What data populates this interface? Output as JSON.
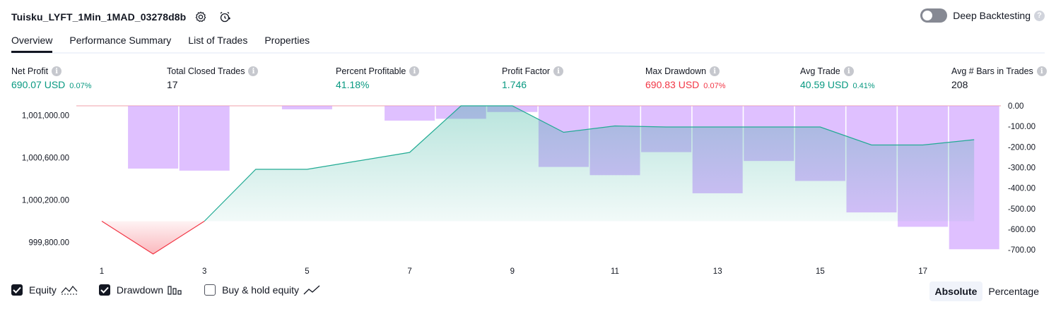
{
  "header": {
    "title": "Tuisku_LYFT_1Min_1MAD_03278d8b",
    "icons": [
      "settings-icon",
      "add-alert-icon"
    ],
    "deep_backtesting_label": "Deep Backtesting",
    "deep_backtesting_enabled": false
  },
  "tabs": [
    {
      "label": "Overview",
      "active": true
    },
    {
      "label": "Performance Summary",
      "active": false
    },
    {
      "label": "List of Trades",
      "active": false
    },
    {
      "label": "Properties",
      "active": false
    }
  ],
  "metrics": [
    {
      "label": "Net Profit",
      "value": "690.07 USD",
      "pct": "0.07%",
      "tone": "pos"
    },
    {
      "label": "Total Closed Trades",
      "value": "17",
      "pct": "",
      "tone": "plain"
    },
    {
      "label": "Percent Profitable",
      "value": "41.18%",
      "pct": "",
      "tone": "pos"
    },
    {
      "label": "Profit Factor",
      "value": "1.746",
      "pct": "",
      "tone": "pos"
    },
    {
      "label": "Max Drawdown",
      "value": "690.83 USD",
      "pct": "0.07%",
      "tone": "neg"
    },
    {
      "label": "Avg Trade",
      "value": "40.59 USD",
      "pct": "0.41%",
      "tone": "pos"
    },
    {
      "label": "Avg # Bars in Trades",
      "value": "208",
      "pct": "",
      "tone": "plain"
    }
  ],
  "chart_data": {
    "type": "area",
    "x": [
      1,
      2,
      3,
      4,
      5,
      6,
      7,
      8,
      9,
      10,
      11,
      12,
      13,
      14,
      15,
      16,
      17,
      18
    ],
    "x_ticks": [
      "1",
      "3",
      "5",
      "7",
      "9",
      "11",
      "13",
      "15",
      "17"
    ],
    "equity_axis_ticks": [
      "1,001,000.00",
      "1,000,600.00",
      "1,000,200.00",
      "999,800.00"
    ],
    "drawdown_axis_ticks": [
      "0.00",
      "-100.00",
      "-200.00",
      "-300.00",
      "-400.00",
      "-500.00",
      "-600.00",
      "-700.00"
    ],
    "equity_baseline": 1000000,
    "equity_ylim": [
      999690,
      1001090
    ],
    "drawdown_ylim": [
      -720,
      10
    ],
    "series": [
      {
        "name": "Equity",
        "chart": "line-area",
        "axis": "left",
        "values": [
          1000000,
          999690,
          1000000,
          1000490,
          1000490,
          1000570,
          1000650,
          1001090,
          1001090,
          1000840,
          1000900,
          1000890,
          1000890,
          1000890,
          1000890,
          1000720,
          1000720,
          1000770
        ]
      },
      {
        "name": "Drawdown",
        "chart": "bar",
        "axis": "right",
        "values": [
          0,
          -305,
          -315,
          0,
          -17,
          0,
          -72,
          -63,
          -30,
          -297,
          -337,
          -225,
          -425,
          -268,
          -365,
          -518,
          -588,
          -697
        ]
      }
    ],
    "colors": {
      "equity_line": "#22ab94",
      "equity_fill_pos": "#a3dccb",
      "equity_fill_neg": "#f7a1a8",
      "equity_line_neg": "#f23645",
      "drawdown_bar": "#cc99ff",
      "zero_line": "#f0a0a8"
    }
  },
  "legend": [
    {
      "label": "Equity",
      "checked": true,
      "icon": "equity-line-icon"
    },
    {
      "label": "Drawdown",
      "checked": true,
      "icon": "drawdown-bars-icon"
    },
    {
      "label": "Buy & hold equity",
      "checked": false,
      "icon": "buy-hold-line-icon"
    }
  ],
  "mode": {
    "absolute_label": "Absolute",
    "percentage_label": "Percentage",
    "selected": "Absolute"
  }
}
